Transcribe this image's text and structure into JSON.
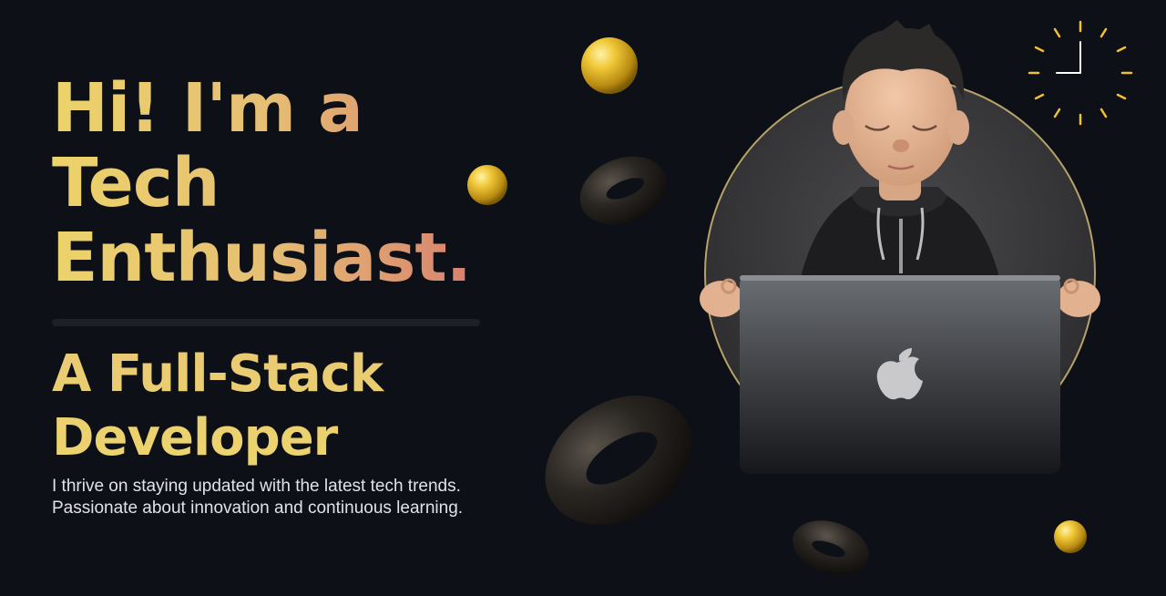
{
  "hero": {
    "headline_line1": "Hi! I'm a Tech",
    "headline_line2": "Enthusiast.",
    "subhead_line1": "A Full-Stack",
    "subhead_line2": "Developer",
    "description_line1": "I thrive on staying updated with the latest tech trends.",
    "description_line2": "Passionate about innovation and continuous learning."
  },
  "colors": {
    "background": "#0d1117",
    "gold_start": "#ecd36a",
    "pink_end": "#d4596c",
    "clock_accent": "#f2c033"
  },
  "icons": {
    "clock": "clock-icon",
    "laptop_logo": "apple-logo-icon"
  }
}
